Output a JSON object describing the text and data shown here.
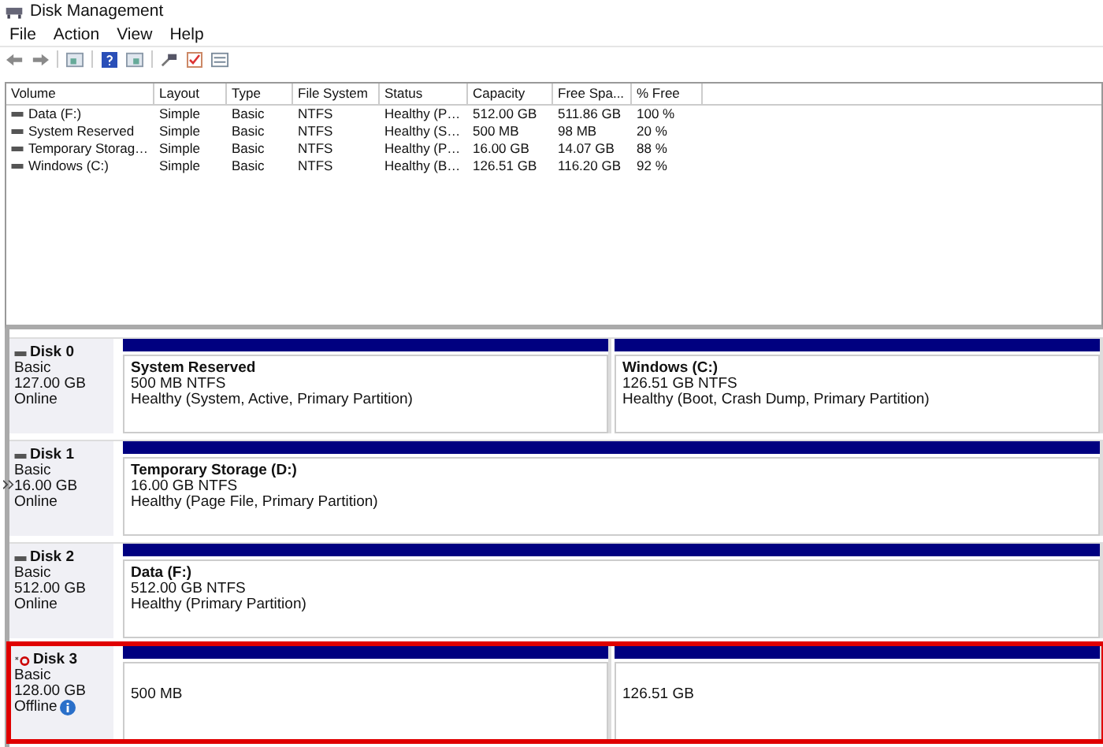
{
  "window": {
    "title": "Disk Management"
  },
  "menu": [
    "File",
    "Action",
    "View",
    "Help"
  ],
  "table": {
    "columns": [
      "Volume",
      "Layout",
      "Type",
      "File System",
      "Status",
      "Capacity",
      "Free Spa...",
      "% Free"
    ],
    "rows": [
      {
        "cells": [
          "Data (F:)",
          "Simple",
          "Basic",
          "NTFS",
          "Healthy (P…",
          "512.00 GB",
          "511.86 GB",
          "100 %"
        ]
      },
      {
        "cells": [
          "System Reserved",
          "Simple",
          "Basic",
          "NTFS",
          "Healthy (S…",
          "500 MB",
          "98 MB",
          "20 %"
        ]
      },
      {
        "cells": [
          "Temporary Storag…",
          "Simple",
          "Basic",
          "NTFS",
          "Healthy (P…",
          "16.00 GB",
          "14.07 GB",
          "88 %"
        ]
      },
      {
        "cells": [
          "Windows (C:)",
          "Simple",
          "Basic",
          "NTFS",
          "Healthy (B…",
          "126.51 GB",
          "116.20 GB",
          "92 %"
        ]
      }
    ]
  },
  "disks": [
    {
      "name": "Disk 0",
      "type": "Basic",
      "size": "127.00 GB",
      "status": "Online",
      "offline": false,
      "highlighted": false,
      "partitions": [
        {
          "name": "System Reserved",
          "detail": "500 MB NTFS",
          "health": "Healthy (System, Active, Primary Partition)"
        },
        {
          "name": "Windows  (C:)",
          "detail": "126.51 GB NTFS",
          "health": "Healthy (Boot, Crash Dump, Primary Partition)"
        }
      ]
    },
    {
      "name": "Disk 1",
      "type": "Basic",
      "size": "16.00 GB",
      "status": "Online",
      "offline": false,
      "highlighted": false,
      "partitions": [
        {
          "name": "Temporary Storage  (D:)",
          "detail": "16.00 GB NTFS",
          "health": "Healthy (Page File, Primary Partition)"
        }
      ]
    },
    {
      "name": "Disk 2",
      "type": "Basic",
      "size": "512.00 GB",
      "status": "Online",
      "offline": false,
      "highlighted": false,
      "partitions": [
        {
          "name": "Data  (F:)",
          "detail": "512.00 GB NTFS",
          "health": "Healthy (Primary Partition)"
        }
      ]
    },
    {
      "name": "Disk 3",
      "type": "Basic",
      "size": "128.00 GB",
      "status": "Offline",
      "offline": true,
      "highlighted": true,
      "partitions": [
        {
          "detail": "500 MB"
        },
        {
          "detail": "126.51 GB"
        }
      ]
    }
  ]
}
